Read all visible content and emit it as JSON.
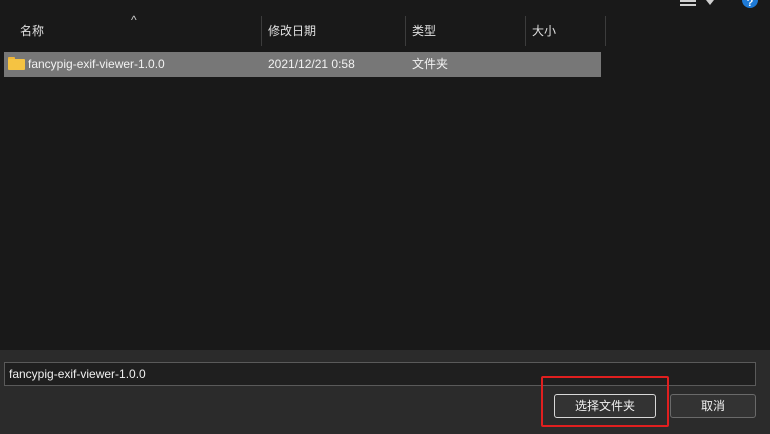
{
  "toolbar": {
    "view_icon": "list-view-icon",
    "help_icon": "help-icon",
    "help_glyph": "?"
  },
  "columns": {
    "name": "名称",
    "modified": "修改日期",
    "type": "类型",
    "size": "大小",
    "sort_glyph": "^"
  },
  "rows": [
    {
      "icon": "folder-icon",
      "name": "fancypig-exif-viewer-1.0.0",
      "modified": "2021/12/21 0:58",
      "type": "文件夹",
      "size": ""
    }
  ],
  "footer": {
    "folder_name_value": "fancypig-exif-viewer-1.0.0",
    "select_button": "选择文件夹",
    "cancel_button": "取消"
  },
  "colors": {
    "background": "#191919",
    "selected_row": "#777777",
    "highlight": "#e01f1f",
    "folder": "#f5c342"
  }
}
